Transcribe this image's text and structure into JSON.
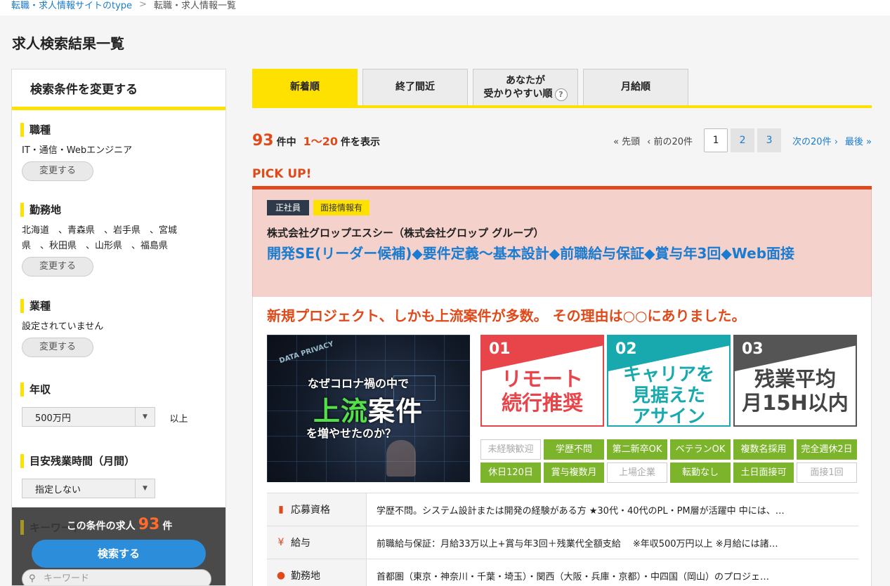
{
  "breadcrumb": [
    "転職・求人情報サイトのtype",
    "転職・求人情報一覧"
  ],
  "page_title": "求人検索結果一覧",
  "sidebar": {
    "heading": "検索条件を変更する",
    "change_label": "変更する",
    "job_type": {
      "title": "職種",
      "value": "IT・通信・Webエンジニア"
    },
    "location": {
      "title": "勤務地",
      "value_line1": "北海道　、青森県　、岩手県　、宮城",
      "value_line2": "県　、秋田県　、山形県　、福島県"
    },
    "industry": {
      "title": "業種",
      "value": "設定されていません"
    },
    "salary": {
      "title": "年収",
      "selected": "500万円",
      "suffix": "以上"
    },
    "overtime": {
      "title": "目安残業時間（月間）",
      "selected": "指定しない"
    },
    "keyword_title": "キーワード",
    "keyword_placeholder": "キーワード",
    "footer": {
      "prefix": "この条件の求人",
      "count": "93",
      "suffix": "件",
      "search_button": "検索する"
    }
  },
  "sort_tabs": [
    {
      "label": "新着順",
      "active": true
    },
    {
      "label": "終了間近",
      "active": false
    },
    {
      "label_line1": "あなたが",
      "label_line2": "受かりやすい順",
      "help": "?",
      "active": false
    },
    {
      "label": "月給順",
      "active": false
    }
  ],
  "results": {
    "total": "93",
    "total_suffix": "件中",
    "range": "1〜20",
    "range_suffix": "件を表示"
  },
  "pager": {
    "first": "« 先頭",
    "prev": "‹ 前の20件",
    "pages": [
      "1",
      "2",
      "3"
    ],
    "current": "1",
    "next": "次の20件 ›",
    "last": "最後 »"
  },
  "pickup": {
    "label": "PICK UP!",
    "badges": [
      "正社員",
      "面接情報有"
    ],
    "company": "株式会社グロップエスシー（株式会社グロップ グループ）",
    "title": "開発SE(リーダー候補)◆要件定義〜基本設計◆前職給与保証◆賞与年3回◆Web面接",
    "catch": "新規プロジェクト、しかも上流案件が多数。 その理由は○○にありました。",
    "hero": {
      "line1": "なぜコロナ禍の中で",
      "line2_a": "上流",
      "line2_b": "案件",
      "line3": "を増やせたのか？",
      "deco": "DATA PRIVACY"
    },
    "features": [
      {
        "num": "01",
        "line1": "リモート",
        "line2": "続行推奨"
      },
      {
        "num": "02",
        "line1": "キャリアを",
        "line2": "見据えた",
        "line3": "アサイン"
      },
      {
        "num": "03",
        "line1": "残業平均",
        "line2": "月15H以内"
      }
    ],
    "tags": [
      {
        "label": "未経験歓迎",
        "on": false
      },
      {
        "label": "学歴不問",
        "on": true
      },
      {
        "label": "第二新卒OK",
        "on": true
      },
      {
        "label": "ベテランOK",
        "on": true
      },
      {
        "label": "複数名採用",
        "on": true
      },
      {
        "label": "完全週休2日",
        "on": true
      },
      {
        "label": "休日120日",
        "on": true
      },
      {
        "label": "賞与複数月",
        "on": true
      },
      {
        "label": "上場企業",
        "on": false
      },
      {
        "label": "転勤なし",
        "on": true
      },
      {
        "label": "土日面接可",
        "on": true
      },
      {
        "label": "面接1回",
        "on": false
      }
    ],
    "info": [
      {
        "icon": "bookmark-icon",
        "label": "応募資格",
        "value": "学歴不問。システム設計または開発の経験がある方 ★30代・40代のPL・PM層が活躍中 中には、…"
      },
      {
        "icon": "yen-icon",
        "label": "給与",
        "value": "前職給与保証：月給33万以上+賞与年3回＋残業代全額支給　 ※年収500万円以上 ※月給には諸…"
      },
      {
        "icon": "map-pin-icon",
        "label": "勤務地",
        "value": "首都圏（東京・神奈川・千葉・埼玉）・関西（大阪・兵庫・京都）・中四国（岡山）のプロジェ…"
      }
    ]
  },
  "colors": {
    "accent_yellow": "#ffe100",
    "accent_orange": "#e04a1a",
    "link_blue": "#1a7bd0",
    "tag_green": "#7cb52b"
  }
}
